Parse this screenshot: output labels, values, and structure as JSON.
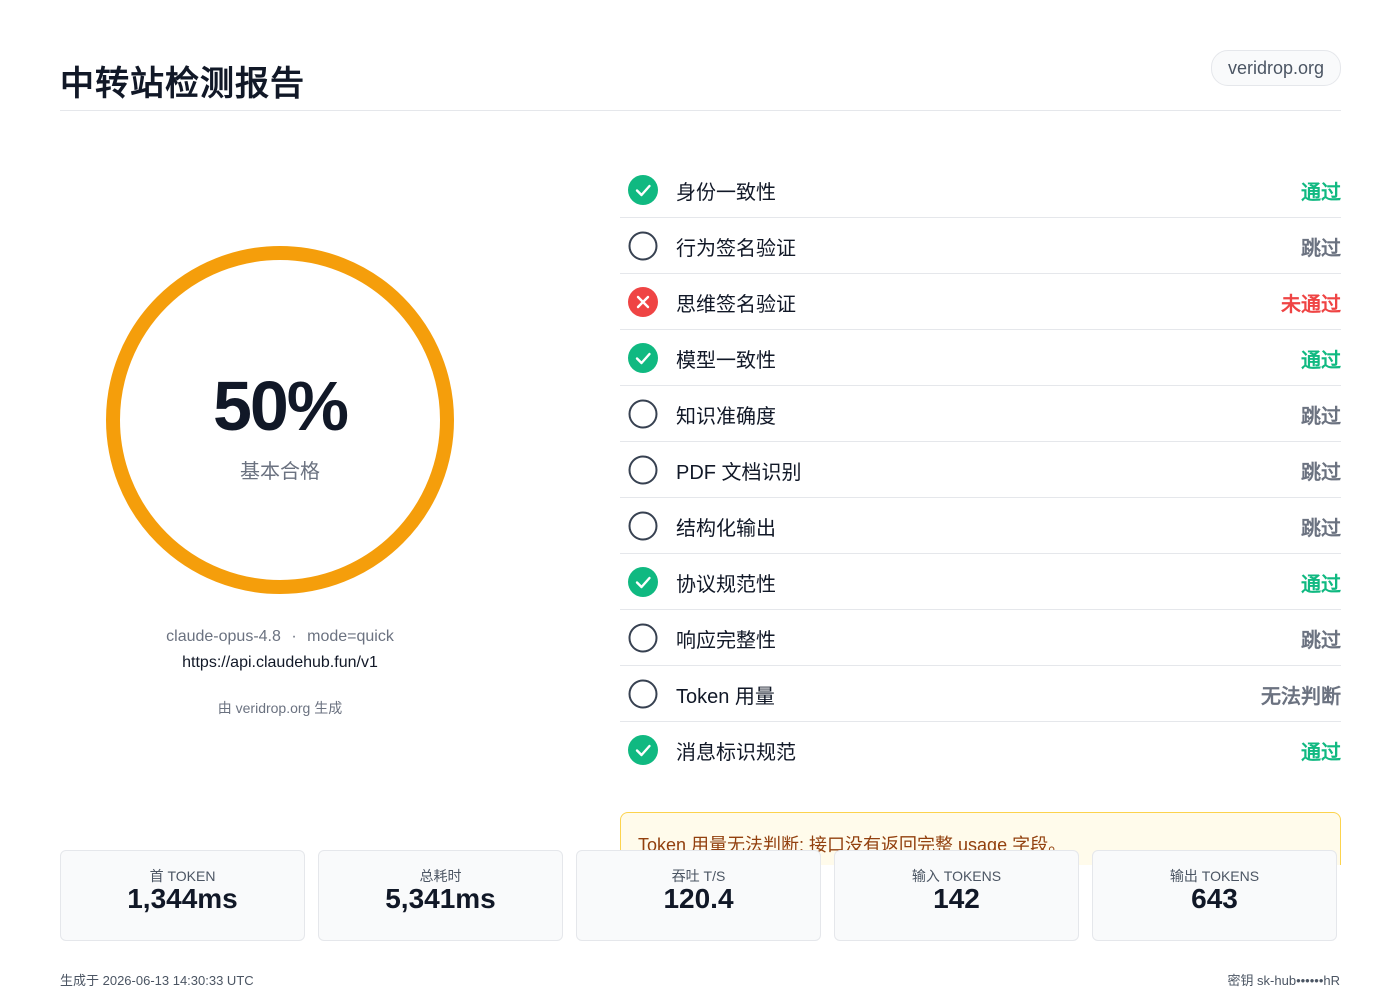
{
  "header": {
    "title": "中转站检测报告",
    "site": "veridrop.org"
  },
  "score": {
    "value": "50%",
    "label": "基本合格",
    "fraction": 0.5,
    "ring_color": "#f59e0b"
  },
  "meta": {
    "model": "claude-opus-4.8",
    "separator": "·",
    "mode": "mode=quick",
    "endpoint": "https://api.claudehub.fun/v1",
    "generated_by": "由 veridrop.org 生成"
  },
  "checks": [
    {
      "name": "身份一致性",
      "status": "通过",
      "state": "pass",
      "icon": "check-circle-icon"
    },
    {
      "name": "行为签名验证",
      "status": "跳过",
      "state": "skip",
      "icon": "empty-circle-icon"
    },
    {
      "name": "思维签名验证",
      "status": "未通过",
      "state": "fail",
      "icon": "x-circle-icon"
    },
    {
      "name": "模型一致性",
      "status": "通过",
      "state": "pass",
      "icon": "check-circle-icon"
    },
    {
      "name": "知识准确度",
      "status": "跳过",
      "state": "skip",
      "icon": "empty-circle-icon"
    },
    {
      "name": "PDF 文档识别",
      "status": "跳过",
      "state": "skip",
      "icon": "empty-circle-icon"
    },
    {
      "name": "结构化输出",
      "status": "跳过",
      "state": "skip",
      "icon": "empty-circle-icon"
    },
    {
      "name": "协议规范性",
      "status": "通过",
      "state": "pass",
      "icon": "check-circle-icon"
    },
    {
      "name": "响应完整性",
      "status": "跳过",
      "state": "skip",
      "icon": "empty-circle-icon"
    },
    {
      "name": "Token 用量",
      "status": "无法判断",
      "state": "skip",
      "icon": "empty-circle-icon"
    },
    {
      "name": "消息标识规范",
      "status": "通过",
      "state": "pass",
      "icon": "check-circle-icon"
    }
  ],
  "warning": {
    "text": "Token 用量无法判断: 接口没有返回完整 usage 字段。"
  },
  "stats": [
    {
      "label": "首 TOKEN",
      "value": "1,344ms"
    },
    {
      "label": "总耗时",
      "value": "5,341ms"
    },
    {
      "label": "吞吐 T/S",
      "value": "120.4"
    },
    {
      "label": "输入 TOKENS",
      "value": "142"
    },
    {
      "label": "输出 TOKENS",
      "value": "643"
    }
  ],
  "footer": {
    "generated_at": "生成于 2026-06-13 14:30:33 UTC",
    "key": "密钥 sk-hub••••••hR"
  },
  "colors": {
    "pass": "#10b981",
    "fail": "#ef4444",
    "skip": "#6b7280",
    "accent": "#f59e0b"
  }
}
